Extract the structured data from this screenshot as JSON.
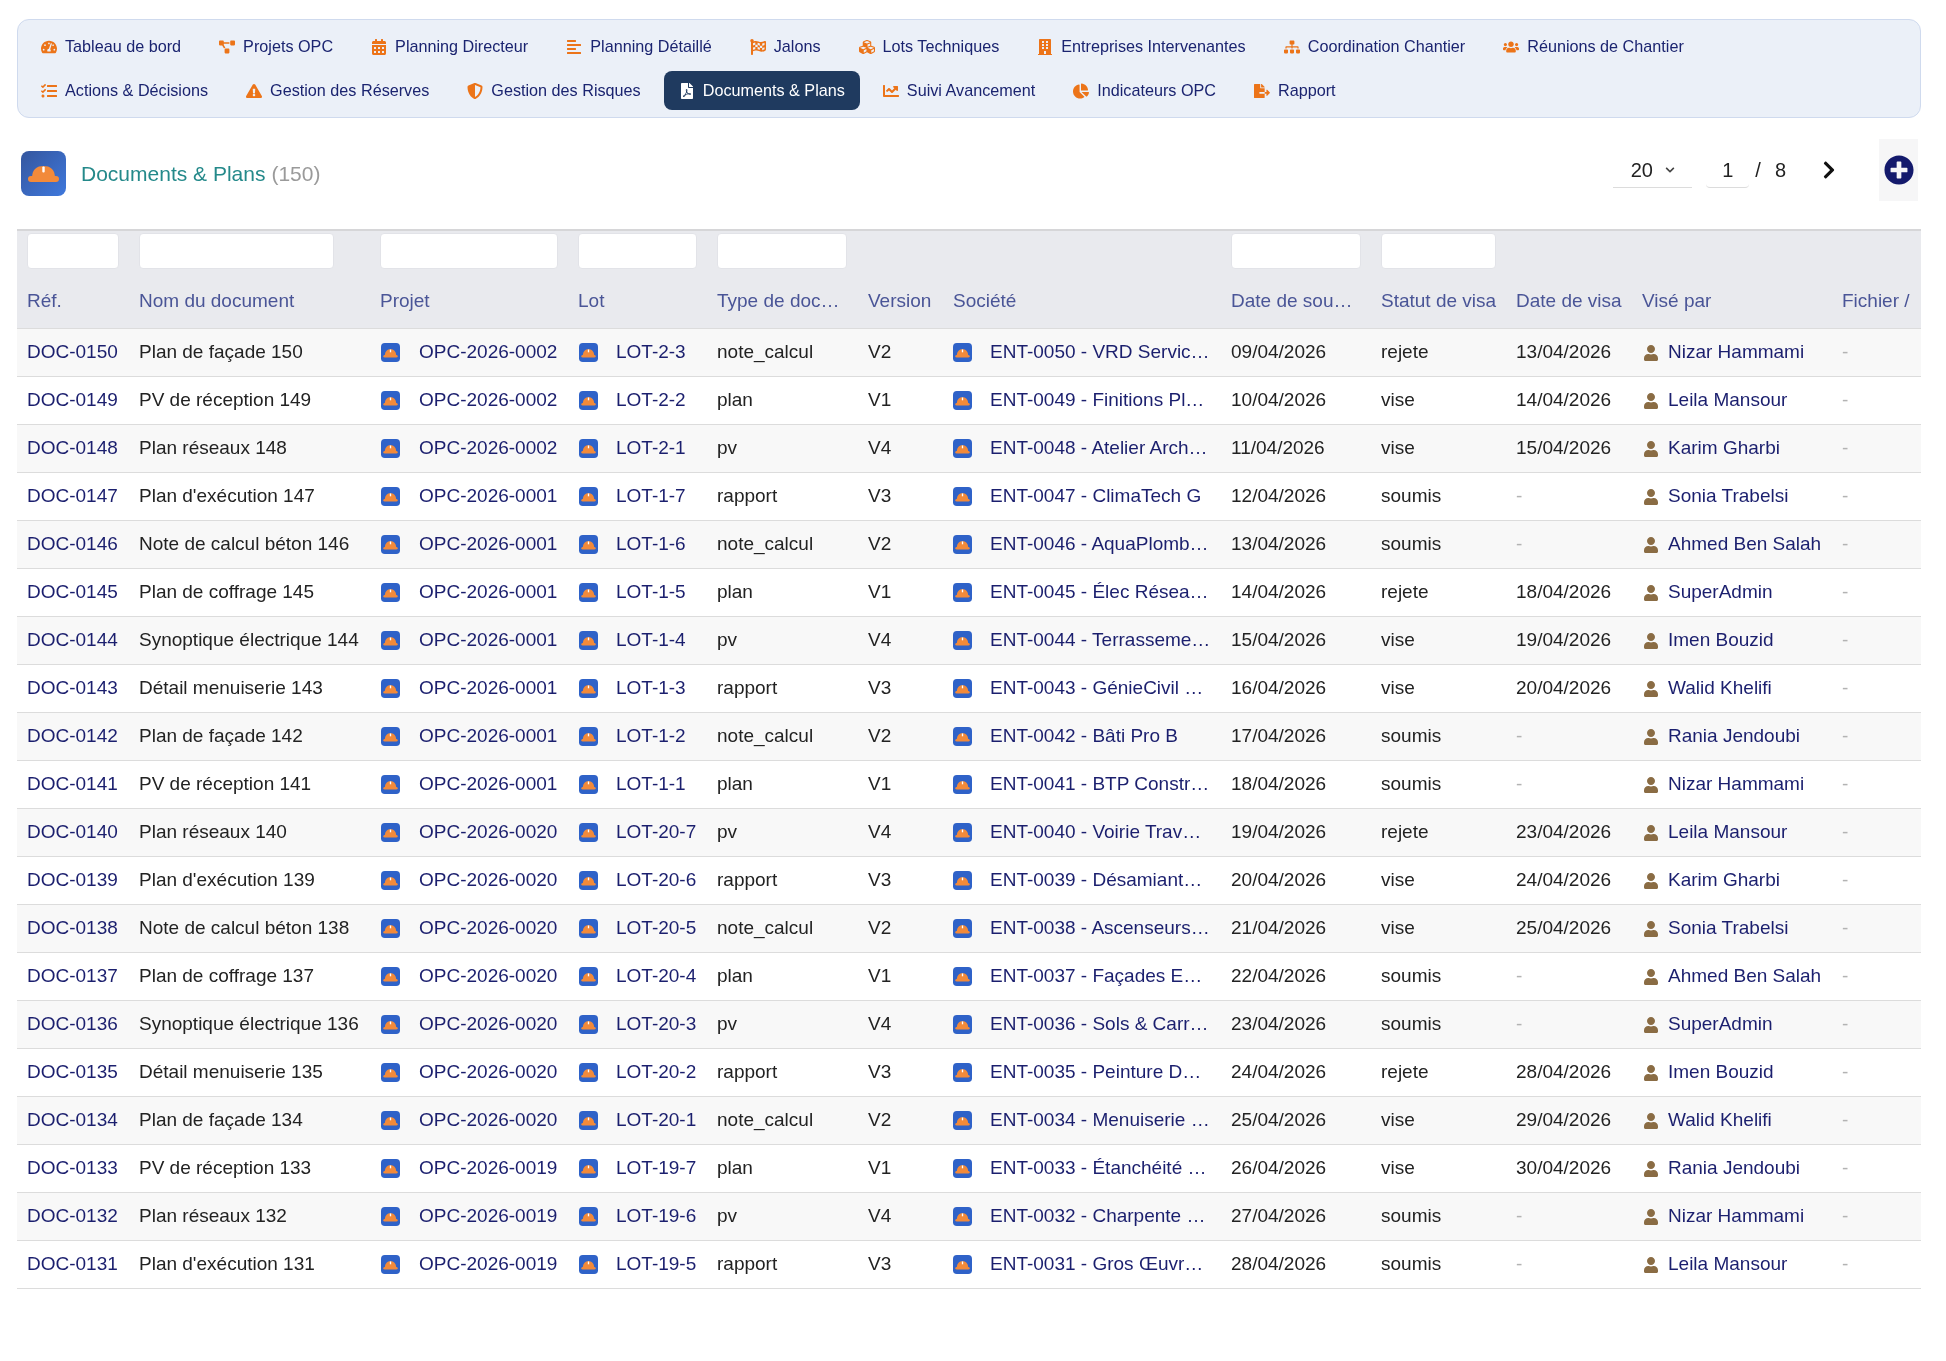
{
  "nav": {
    "items": [
      {
        "label": "Tableau de bord",
        "selected": false
      },
      {
        "label": "Projets OPC",
        "selected": false
      },
      {
        "label": "Planning Directeur",
        "selected": false
      },
      {
        "label": "Planning Détaillé",
        "selected": false
      },
      {
        "label": "Jalons",
        "selected": false
      },
      {
        "label": "Lots Techniques",
        "selected": false
      },
      {
        "label": "Entreprises Intervenantes",
        "selected": false
      },
      {
        "label": "Coordination Chantier",
        "selected": false
      },
      {
        "label": "Réunions de Chantier",
        "selected": false
      },
      {
        "label": "Actions & Décisions",
        "selected": false
      },
      {
        "label": "Gestion des Réserves",
        "selected": false
      },
      {
        "label": "Gestion des Risques",
        "selected": false
      },
      {
        "label": "Documents & Plans",
        "selected": true
      },
      {
        "label": "Suivi Avancement",
        "selected": false
      },
      {
        "label": "Indicateurs OPC",
        "selected": false
      },
      {
        "label": "Rapport",
        "selected": false
      }
    ]
  },
  "header": {
    "title": "Documents & Plans",
    "count": "(150)"
  },
  "pagination": {
    "page_size": "20",
    "page": "1",
    "separator": "/",
    "total_pages": "8"
  },
  "table": {
    "columns": [
      {
        "label": "Réf.",
        "filterable": true
      },
      {
        "label": "Nom du document",
        "filterable": true
      },
      {
        "label": "Projet",
        "filterable": true
      },
      {
        "label": "Lot",
        "filterable": true
      },
      {
        "label": "Type de doc…",
        "filterable": true
      },
      {
        "label": "Version",
        "filterable": false
      },
      {
        "label": "Société",
        "filterable": false
      },
      {
        "label": "Date de sou…",
        "filterable": true
      },
      {
        "label": "Statut de visa",
        "filterable": true
      },
      {
        "label": "Date de visa",
        "filterable": false
      },
      {
        "label": "Visé par",
        "filterable": false
      },
      {
        "label": "Fichier /",
        "filterable": false
      }
    ],
    "rows": [
      {
        "ref": "DOC-0150",
        "name": "Plan de façade 150",
        "project": "OPC-2026-0002",
        "lot": "LOT-2-3",
        "type": "note_calcul",
        "version": "V2",
        "company": "ENT-0050 - VRD Servic…",
        "submitted": "09/04/2026",
        "visa_status": "rejete",
        "visa_date": "13/04/2026",
        "visa_date_muted": false,
        "approver": "Nizar Hammami",
        "file": "-"
      },
      {
        "ref": "DOC-0149",
        "name": "PV de réception 149",
        "project": "OPC-2026-0002",
        "lot": "LOT-2-2",
        "type": "plan",
        "version": "V1",
        "company": "ENT-0049 - Finitions Pl…",
        "submitted": "10/04/2026",
        "visa_status": "vise",
        "visa_date": "14/04/2026",
        "visa_date_muted": false,
        "approver": "Leila Mansour",
        "file": "-"
      },
      {
        "ref": "DOC-0148",
        "name": "Plan réseaux 148",
        "project": "OPC-2026-0002",
        "lot": "LOT-2-1",
        "type": "pv",
        "version": "V4",
        "company": "ENT-0048 - Atelier Arch…",
        "submitted": "11/04/2026",
        "visa_status": "vise",
        "visa_date": "15/04/2026",
        "visa_date_muted": false,
        "approver": "Karim Gharbi",
        "file": "-"
      },
      {
        "ref": "DOC-0147",
        "name": "Plan d'exécution 147",
        "project": "OPC-2026-0001",
        "lot": "LOT-1-7",
        "type": "rapport",
        "version": "V3",
        "company": "ENT-0047 - ClimaTech G",
        "submitted": "12/04/2026",
        "visa_status": "soumis",
        "visa_date": "-",
        "visa_date_muted": true,
        "approver": "Sonia Trabelsi",
        "file": "-"
      },
      {
        "ref": "DOC-0146",
        "name": "Note de calcul béton 146",
        "project": "OPC-2026-0001",
        "lot": "LOT-1-6",
        "type": "note_calcul",
        "version": "V2",
        "company": "ENT-0046 - AquaPlomb…",
        "submitted": "13/04/2026",
        "visa_status": "soumis",
        "visa_date": "-",
        "visa_date_muted": true,
        "approver": "Ahmed Ben Salah",
        "file": "-"
      },
      {
        "ref": "DOC-0145",
        "name": "Plan de coffrage 145",
        "project": "OPC-2026-0001",
        "lot": "LOT-1-5",
        "type": "plan",
        "version": "V1",
        "company": "ENT-0045 - Élec Résea…",
        "submitted": "14/04/2026",
        "visa_status": "rejete",
        "visa_date": "18/04/2026",
        "visa_date_muted": false,
        "approver": "SuperAdmin",
        "file": "-"
      },
      {
        "ref": "DOC-0144",
        "name": "Synoptique électrique 144",
        "project": "OPC-2026-0001",
        "lot": "LOT-1-4",
        "type": "pv",
        "version": "V4",
        "company": "ENT-0044 - Terrasseme…",
        "submitted": "15/04/2026",
        "visa_status": "vise",
        "visa_date": "19/04/2026",
        "visa_date_muted": false,
        "approver": "Imen Bouzid",
        "file": "-"
      },
      {
        "ref": "DOC-0143",
        "name": "Détail menuiserie 143",
        "project": "OPC-2026-0001",
        "lot": "LOT-1-3",
        "type": "rapport",
        "version": "V3",
        "company": "ENT-0043 - GénieCivil …",
        "submitted": "16/04/2026",
        "visa_status": "vise",
        "visa_date": "20/04/2026",
        "visa_date_muted": false,
        "approver": "Walid Khelifi",
        "file": "-"
      },
      {
        "ref": "DOC-0142",
        "name": "Plan de façade 142",
        "project": "OPC-2026-0001",
        "lot": "LOT-1-2",
        "type": "note_calcul",
        "version": "V2",
        "company": "ENT-0042 - Bâti Pro B",
        "submitted": "17/04/2026",
        "visa_status": "soumis",
        "visa_date": "-",
        "visa_date_muted": true,
        "approver": "Rania Jendoubi",
        "file": "-"
      },
      {
        "ref": "DOC-0141",
        "name": "PV de réception 141",
        "project": "OPC-2026-0001",
        "lot": "LOT-1-1",
        "type": "plan",
        "version": "V1",
        "company": "ENT-0041 - BTP Constr…",
        "submitted": "18/04/2026",
        "visa_status": "soumis",
        "visa_date": "-",
        "visa_date_muted": true,
        "approver": "Nizar Hammami",
        "file": "-"
      },
      {
        "ref": "DOC-0140",
        "name": "Plan réseaux 140",
        "project": "OPC-2026-0020",
        "lot": "LOT-20-7",
        "type": "pv",
        "version": "V4",
        "company": "ENT-0040 - Voirie Trav…",
        "submitted": "19/04/2026",
        "visa_status": "rejete",
        "visa_date": "23/04/2026",
        "visa_date_muted": false,
        "approver": "Leila Mansour",
        "file": "-"
      },
      {
        "ref": "DOC-0139",
        "name": "Plan d'exécution 139",
        "project": "OPC-2026-0020",
        "lot": "LOT-20-6",
        "type": "rapport",
        "version": "V3",
        "company": "ENT-0039 - Désamiant…",
        "submitted": "20/04/2026",
        "visa_status": "vise",
        "visa_date": "24/04/2026",
        "visa_date_muted": false,
        "approver": "Karim Gharbi",
        "file": "-"
      },
      {
        "ref": "DOC-0138",
        "name": "Note de calcul béton 138",
        "project": "OPC-2026-0020",
        "lot": "LOT-20-5",
        "type": "note_calcul",
        "version": "V2",
        "company": "ENT-0038 - Ascenseurs…",
        "submitted": "21/04/2026",
        "visa_status": "vise",
        "visa_date": "25/04/2026",
        "visa_date_muted": false,
        "approver": "Sonia Trabelsi",
        "file": "-"
      },
      {
        "ref": "DOC-0137",
        "name": "Plan de coffrage 137",
        "project": "OPC-2026-0020",
        "lot": "LOT-20-4",
        "type": "plan",
        "version": "V1",
        "company": "ENT-0037 - Façades E…",
        "submitted": "22/04/2026",
        "visa_status": "soumis",
        "visa_date": "-",
        "visa_date_muted": true,
        "approver": "Ahmed Ben Salah",
        "file": "-"
      },
      {
        "ref": "DOC-0136",
        "name": "Synoptique électrique 136",
        "project": "OPC-2026-0020",
        "lot": "LOT-20-3",
        "type": "pv",
        "version": "V4",
        "company": "ENT-0036 - Sols & Carr…",
        "submitted": "23/04/2026",
        "visa_status": "soumis",
        "visa_date": "-",
        "visa_date_muted": true,
        "approver": "SuperAdmin",
        "file": "-"
      },
      {
        "ref": "DOC-0135",
        "name": "Détail menuiserie 135",
        "project": "OPC-2026-0020",
        "lot": "LOT-20-2",
        "type": "rapport",
        "version": "V3",
        "company": "ENT-0035 - Peinture D…",
        "submitted": "24/04/2026",
        "visa_status": "rejete",
        "visa_date": "28/04/2026",
        "visa_date_muted": false,
        "approver": "Imen Bouzid",
        "file": "-"
      },
      {
        "ref": "DOC-0134",
        "name": "Plan de façade 134",
        "project": "OPC-2026-0020",
        "lot": "LOT-20-1",
        "type": "note_calcul",
        "version": "V2",
        "company": "ENT-0034 - Menuiserie …",
        "submitted": "25/04/2026",
        "visa_status": "vise",
        "visa_date": "29/04/2026",
        "visa_date_muted": false,
        "approver": "Walid Khelifi",
        "file": "-"
      },
      {
        "ref": "DOC-0133",
        "name": "PV de réception 133",
        "project": "OPC-2026-0019",
        "lot": "LOT-19-7",
        "type": "plan",
        "version": "V1",
        "company": "ENT-0033 - Étanchéité …",
        "submitted": "26/04/2026",
        "visa_status": "vise",
        "visa_date": "30/04/2026",
        "visa_date_muted": false,
        "approver": "Rania Jendoubi",
        "file": "-"
      },
      {
        "ref": "DOC-0132",
        "name": "Plan réseaux 132",
        "project": "OPC-2026-0019",
        "lot": "LOT-19-6",
        "type": "pv",
        "version": "V4",
        "company": "ENT-0032 - Charpente …",
        "submitted": "27/04/2026",
        "visa_status": "soumis",
        "visa_date": "-",
        "visa_date_muted": true,
        "approver": "Nizar Hammami",
        "file": "-"
      },
      {
        "ref": "DOC-0131",
        "name": "Plan d'exécution 131",
        "project": "OPC-2026-0019",
        "lot": "LOT-19-5",
        "type": "rapport",
        "version": "V3",
        "company": "ENT-0031 - Gros Œuvr…",
        "submitted": "28/04/2026",
        "visa_status": "soumis",
        "visa_date": "-",
        "visa_date_muted": true,
        "approver": "Leila Mansour",
        "file": "-"
      }
    ]
  }
}
